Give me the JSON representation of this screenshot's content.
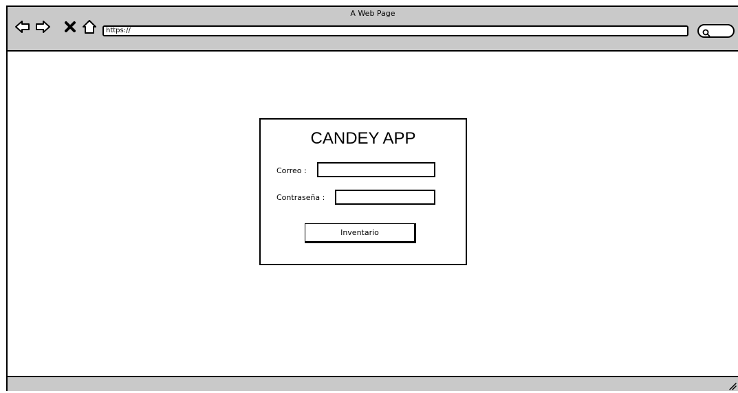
{
  "browser": {
    "title": "A Web Page",
    "url": "https://",
    "nav_icons": [
      "back-icon",
      "forward-icon",
      "close-icon",
      "home-icon"
    ],
    "search_icon": "search-icon"
  },
  "login": {
    "title": "CANDEY APP",
    "email_label": "Correo :",
    "password_label": "Contraseña :",
    "email_value": "",
    "password_value": "",
    "button_label": "Inventario"
  },
  "colors": {
    "chrome": "#c9c9c9",
    "border": "#000000",
    "background": "#ffffff"
  }
}
